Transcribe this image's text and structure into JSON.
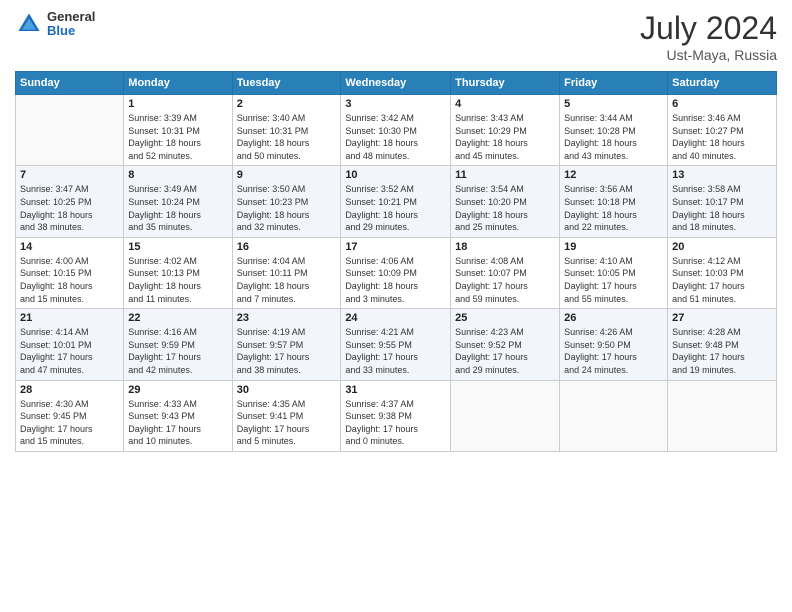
{
  "header": {
    "logo_general": "General",
    "logo_blue": "Blue",
    "month_title": "July 2024",
    "location": "Ust-Maya, Russia"
  },
  "calendar": {
    "columns": [
      "Sunday",
      "Monday",
      "Tuesday",
      "Wednesday",
      "Thursday",
      "Friday",
      "Saturday"
    ],
    "weeks": [
      [
        {
          "day": "",
          "info": ""
        },
        {
          "day": "1",
          "info": "Sunrise: 3:39 AM\nSunset: 10:31 PM\nDaylight: 18 hours\nand 52 minutes."
        },
        {
          "day": "2",
          "info": "Sunrise: 3:40 AM\nSunset: 10:31 PM\nDaylight: 18 hours\nand 50 minutes."
        },
        {
          "day": "3",
          "info": "Sunrise: 3:42 AM\nSunset: 10:30 PM\nDaylight: 18 hours\nand 48 minutes."
        },
        {
          "day": "4",
          "info": "Sunrise: 3:43 AM\nSunset: 10:29 PM\nDaylight: 18 hours\nand 45 minutes."
        },
        {
          "day": "5",
          "info": "Sunrise: 3:44 AM\nSunset: 10:28 PM\nDaylight: 18 hours\nand 43 minutes."
        },
        {
          "day": "6",
          "info": "Sunrise: 3:46 AM\nSunset: 10:27 PM\nDaylight: 18 hours\nand 40 minutes."
        }
      ],
      [
        {
          "day": "7",
          "info": "Sunrise: 3:47 AM\nSunset: 10:25 PM\nDaylight: 18 hours\nand 38 minutes."
        },
        {
          "day": "8",
          "info": "Sunrise: 3:49 AM\nSunset: 10:24 PM\nDaylight: 18 hours\nand 35 minutes."
        },
        {
          "day": "9",
          "info": "Sunrise: 3:50 AM\nSunset: 10:23 PM\nDaylight: 18 hours\nand 32 minutes."
        },
        {
          "day": "10",
          "info": "Sunrise: 3:52 AM\nSunset: 10:21 PM\nDaylight: 18 hours\nand 29 minutes."
        },
        {
          "day": "11",
          "info": "Sunrise: 3:54 AM\nSunset: 10:20 PM\nDaylight: 18 hours\nand 25 minutes."
        },
        {
          "day": "12",
          "info": "Sunrise: 3:56 AM\nSunset: 10:18 PM\nDaylight: 18 hours\nand 22 minutes."
        },
        {
          "day": "13",
          "info": "Sunrise: 3:58 AM\nSunset: 10:17 PM\nDaylight: 18 hours\nand 18 minutes."
        }
      ],
      [
        {
          "day": "14",
          "info": "Sunrise: 4:00 AM\nSunset: 10:15 PM\nDaylight: 18 hours\nand 15 minutes."
        },
        {
          "day": "15",
          "info": "Sunrise: 4:02 AM\nSunset: 10:13 PM\nDaylight: 18 hours\nand 11 minutes."
        },
        {
          "day": "16",
          "info": "Sunrise: 4:04 AM\nSunset: 10:11 PM\nDaylight: 18 hours\nand 7 minutes."
        },
        {
          "day": "17",
          "info": "Sunrise: 4:06 AM\nSunset: 10:09 PM\nDaylight: 18 hours\nand 3 minutes."
        },
        {
          "day": "18",
          "info": "Sunrise: 4:08 AM\nSunset: 10:07 PM\nDaylight: 17 hours\nand 59 minutes."
        },
        {
          "day": "19",
          "info": "Sunrise: 4:10 AM\nSunset: 10:05 PM\nDaylight: 17 hours\nand 55 minutes."
        },
        {
          "day": "20",
          "info": "Sunrise: 4:12 AM\nSunset: 10:03 PM\nDaylight: 17 hours\nand 51 minutes."
        }
      ],
      [
        {
          "day": "21",
          "info": "Sunrise: 4:14 AM\nSunset: 10:01 PM\nDaylight: 17 hours\nand 47 minutes."
        },
        {
          "day": "22",
          "info": "Sunrise: 4:16 AM\nSunset: 9:59 PM\nDaylight: 17 hours\nand 42 minutes."
        },
        {
          "day": "23",
          "info": "Sunrise: 4:19 AM\nSunset: 9:57 PM\nDaylight: 17 hours\nand 38 minutes."
        },
        {
          "day": "24",
          "info": "Sunrise: 4:21 AM\nSunset: 9:55 PM\nDaylight: 17 hours\nand 33 minutes."
        },
        {
          "day": "25",
          "info": "Sunrise: 4:23 AM\nSunset: 9:52 PM\nDaylight: 17 hours\nand 29 minutes."
        },
        {
          "day": "26",
          "info": "Sunrise: 4:26 AM\nSunset: 9:50 PM\nDaylight: 17 hours\nand 24 minutes."
        },
        {
          "day": "27",
          "info": "Sunrise: 4:28 AM\nSunset: 9:48 PM\nDaylight: 17 hours\nand 19 minutes."
        }
      ],
      [
        {
          "day": "28",
          "info": "Sunrise: 4:30 AM\nSunset: 9:45 PM\nDaylight: 17 hours\nand 15 minutes."
        },
        {
          "day": "29",
          "info": "Sunrise: 4:33 AM\nSunset: 9:43 PM\nDaylight: 17 hours\nand 10 minutes."
        },
        {
          "day": "30",
          "info": "Sunrise: 4:35 AM\nSunset: 9:41 PM\nDaylight: 17 hours\nand 5 minutes."
        },
        {
          "day": "31",
          "info": "Sunrise: 4:37 AM\nSunset: 9:38 PM\nDaylight: 17 hours\nand 0 minutes."
        },
        {
          "day": "",
          "info": ""
        },
        {
          "day": "",
          "info": ""
        },
        {
          "day": "",
          "info": ""
        }
      ]
    ]
  }
}
